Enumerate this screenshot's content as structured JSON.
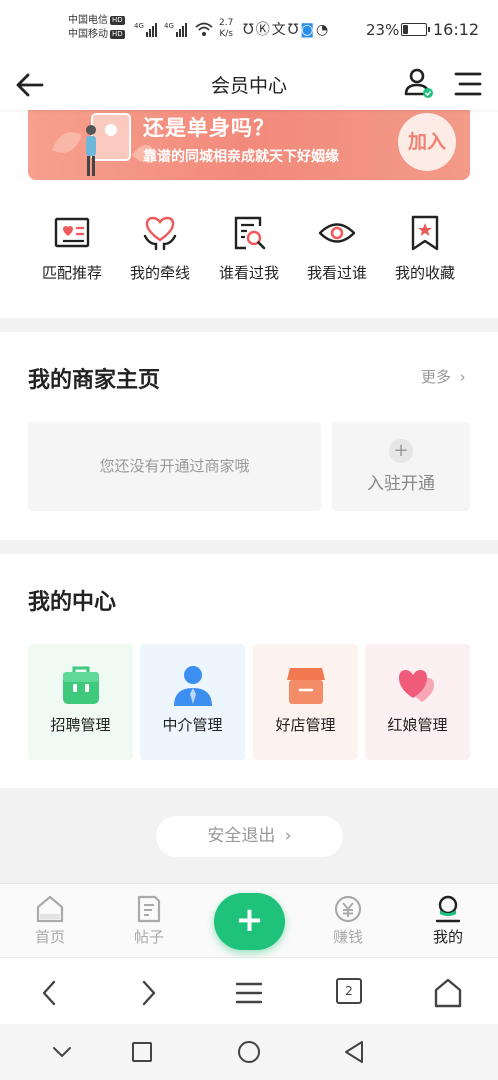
{
  "status_bar": {
    "carrier1": "中国电信",
    "carrier2": "中国移动",
    "hd_badge": "HD",
    "net_speed_value": "2.7",
    "net_speed_unit": "K/s",
    "battery_text": "23%",
    "battery_level": 0.23,
    "time": "16:12"
  },
  "header": {
    "title": "会员中心"
  },
  "banner": {
    "title": "还是单身吗？",
    "subtitle": "靠谱的同城相亲成就天下好姻缘",
    "join_label": "加入"
  },
  "quick_actions": [
    {
      "label": "匹配推荐",
      "icon": "match-card-icon"
    },
    {
      "label": "我的牵线",
      "icon": "heart-hands-icon"
    },
    {
      "label": "谁看过我",
      "icon": "search-document-icon"
    },
    {
      "label": "我看过谁",
      "icon": "eye-icon"
    },
    {
      "label": "我的收藏",
      "icon": "bookmark-star-icon"
    }
  ],
  "merchant": {
    "title": "我的商家主页",
    "more_label": "更多",
    "empty_text": "您还没有开通过商家哦",
    "open_plus": "+",
    "open_label": "入驻开通"
  },
  "my_center": {
    "title": "我的中心",
    "cards": [
      {
        "label": "招聘管理",
        "icon": "briefcase-icon",
        "bg": "#effaf3",
        "color": "#3ec97c"
      },
      {
        "label": "中介管理",
        "icon": "agent-person-icon",
        "bg": "#edf5fd",
        "color": "#3c8ff0"
      },
      {
        "label": "好店管理",
        "icon": "shop-box-icon",
        "bg": "#fdf3ee",
        "color": "#f2794f"
      },
      {
        "label": "红娘管理",
        "icon": "double-heart-icon",
        "bg": "#fdf0f2",
        "color": "#ef5b78"
      }
    ]
  },
  "logout": {
    "label": "安全退出"
  },
  "tabbar": {
    "items": [
      {
        "label": "首页",
        "icon": "home-icon"
      },
      {
        "label": "帖子",
        "icon": "post-icon"
      },
      {
        "label": "赚钱",
        "icon": "coin-icon"
      },
      {
        "label": "我的",
        "icon": "profile-icon"
      }
    ],
    "fab_label": "+",
    "accent": "#1ec27a"
  },
  "browser_bar": {
    "tab_count": "2"
  }
}
